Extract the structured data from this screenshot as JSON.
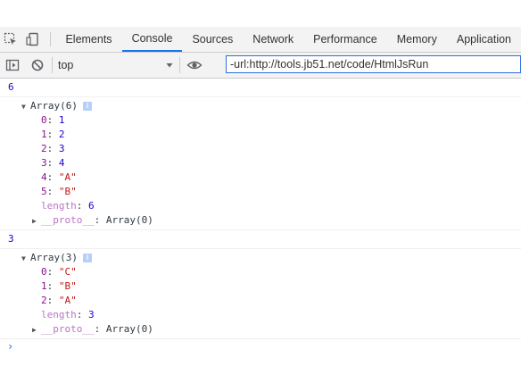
{
  "tabs": [
    "Elements",
    "Console",
    "Sources",
    "Network",
    "Performance",
    "Memory",
    "Application"
  ],
  "active_tab": "Console",
  "toolbar": {
    "context": "top",
    "filter_value": "-url:http://tools.jb51.net/code/HtmlJsRun"
  },
  "console": {
    "log1": "6",
    "array1": {
      "header": "Array(6)",
      "items": [
        {
          "key": "0",
          "value": "1"
        },
        {
          "key": "1",
          "value": "2"
        },
        {
          "key": "2",
          "value": "3"
        },
        {
          "key": "3",
          "value": "4"
        },
        {
          "key": "4",
          "value": "\"A\""
        },
        {
          "key": "5",
          "value": "\"B\""
        }
      ],
      "length_key": "length",
      "length_value": "6",
      "proto_key": "__proto__",
      "proto_value": "Array(0)"
    },
    "log2": "3",
    "array2": {
      "header": "Array(3)",
      "items": [
        {
          "key": "0",
          "value": "\"C\""
        },
        {
          "key": "1",
          "value": "\"B\""
        },
        {
          "key": "2",
          "value": "\"A\""
        }
      ],
      "length_key": "length",
      "length_value": "3",
      "proto_key": "__proto__",
      "proto_value": "Array(0)"
    },
    "prompt": "›",
    "info_glyph": "i"
  }
}
